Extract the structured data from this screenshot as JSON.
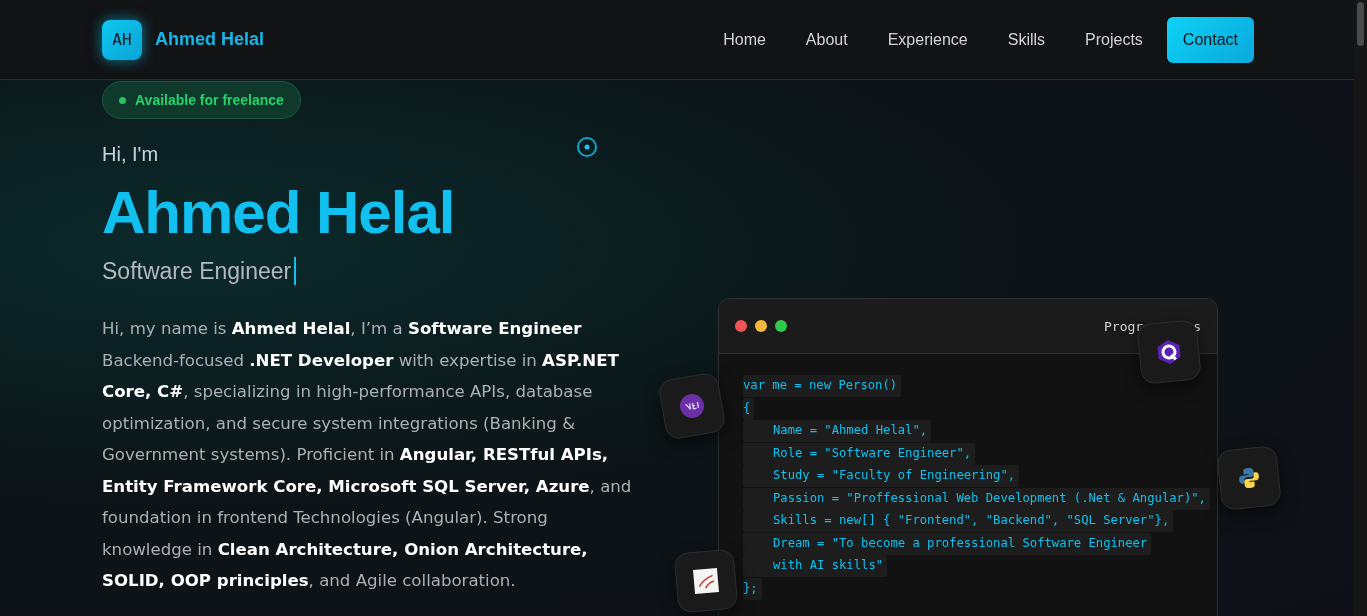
{
  "brand": {
    "initials": "AH",
    "name": "Ahmed Helal"
  },
  "nav": [
    {
      "label": "Home",
      "kind": "link"
    },
    {
      "label": "About",
      "kind": "link"
    },
    {
      "label": "Experience",
      "kind": "link"
    },
    {
      "label": "Skills",
      "kind": "link"
    },
    {
      "label": "Projects",
      "kind": "link"
    },
    {
      "label": "Contact",
      "kind": "cta"
    }
  ],
  "status_badge": {
    "label": "Available for freelance",
    "color": "#22c55e"
  },
  "greeting": "Hi, I'm",
  "name": "Ahmed Helal",
  "role": "Software Engineer",
  "bio": "Hi, my name is **Ahmed Helal**, I’m a **Software Engineer** Backend-focused **.NET Developer** with expertise in **ASP.NET Core, C#**, specializing in high-performance APIs, database optimization, and secure system integrations (Banking & Government systems). Proficient in **Angular, RESTful APIs, Entity Framework Core, Microsoft SQL Server, Azure**, and foundation in frontend Technologies (Angular). Strong knowledge in **Clean Architecture, Onion Architecture, SOLID, OOP principles**, and Agile collaboration.",
  "code_window": {
    "title_parts": [
      "Progr",
      "s"
    ],
    "lines": [
      {
        "text": "var me = new Person()",
        "indented": false
      },
      {
        "text": "{",
        "indented": false
      },
      {
        "text": "Name = \"Ahmed Helal\",",
        "indented": true
      },
      {
        "text": "Role = \"Software Engineer\",",
        "indented": true
      },
      {
        "text": "Study = \"Faculty of Engineering\",",
        "indented": true
      },
      {
        "text": "Passion = \"Proffessional Web Development (.Net & Angular)\",",
        "indented": true
      },
      {
        "text": "Skills = new[] { \"Frontend\", \"Backend\", \"SQL Server\"},",
        "indented": true
      },
      {
        "text": "Dream = \"To become a professional Software Engineer",
        "indented": true
      },
      {
        "text": "with AI skills\"",
        "indented": true
      },
      {
        "text": "};",
        "indented": false
      }
    ]
  }
}
